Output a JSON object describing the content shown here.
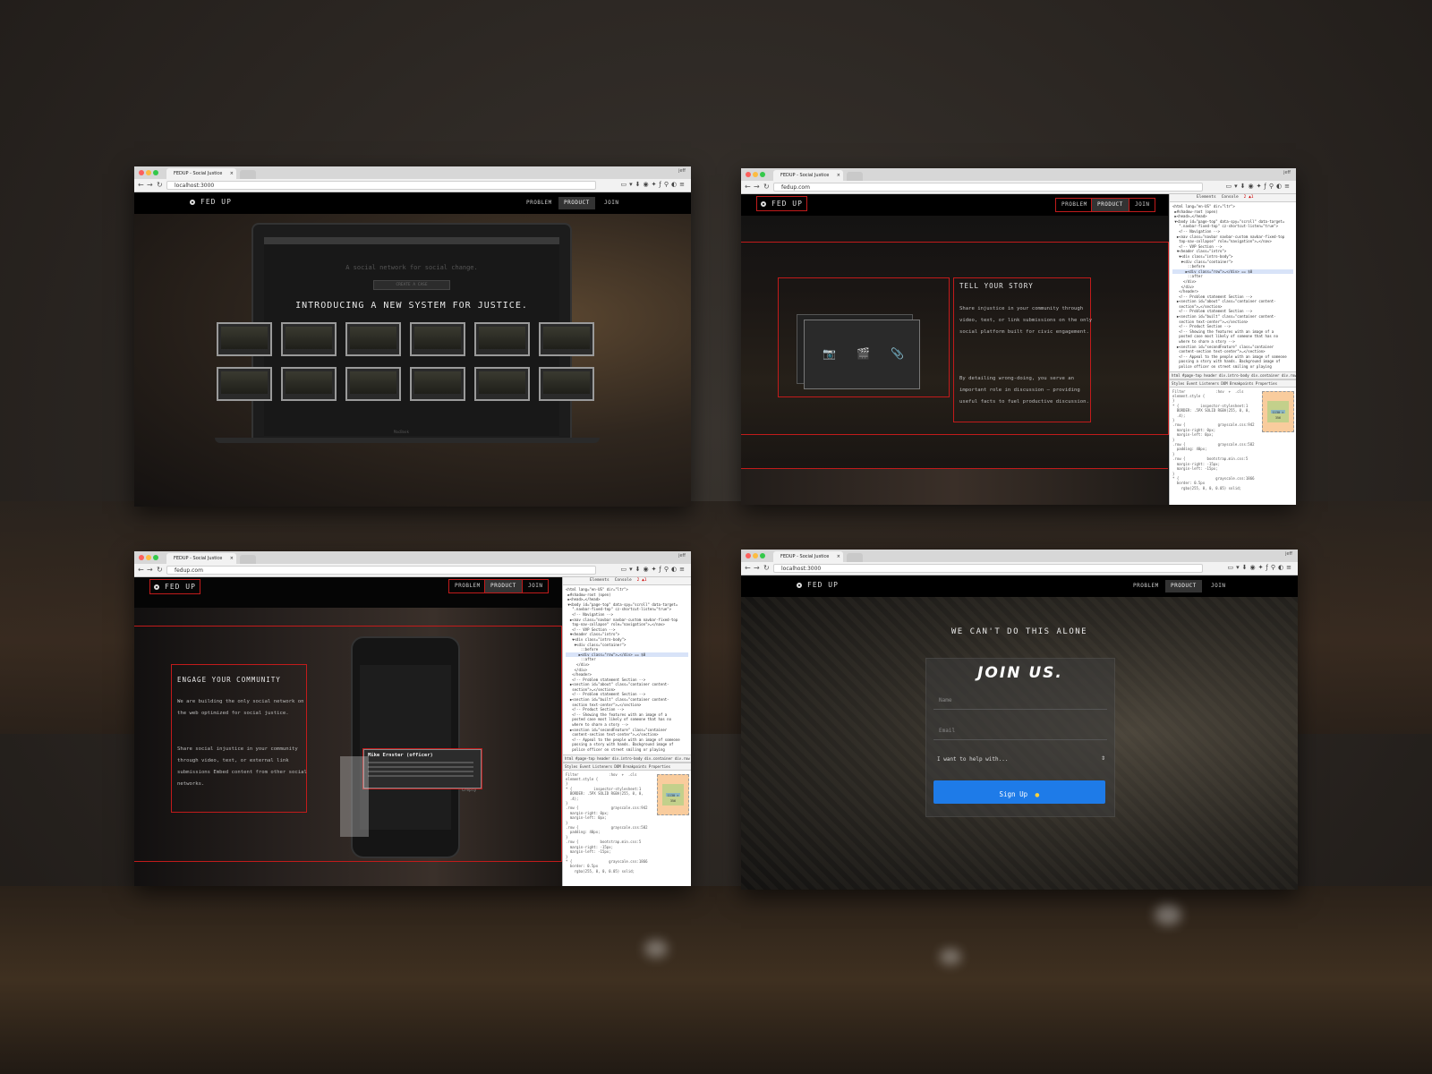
{
  "windows": {
    "w1": {
      "tab_title": "FEDUP - Social Justice",
      "user": "jeff",
      "url": "localhost:3000",
      "brand": "FED UP",
      "nav": [
        "PROBLEM",
        "PRODUCT",
        "JOIN"
      ],
      "laptop_tagline": "A social network for social change.",
      "laptop_button": "CREATE A CASE",
      "headline": "INTRODUCING A NEW SYSTEM FOR JUSTICE.",
      "laptop_brand": "MacBook",
      "card_count": 12
    },
    "w2": {
      "tab_title": "FEDUP - Social Justice",
      "user": "jeff",
      "url": "fedup.com",
      "brand": "FED UP",
      "nav": [
        "PROBLEM",
        "PRODUCT",
        "JOIN"
      ],
      "heading": "TELL YOUR STORY",
      "para1": "Share injustice in your community through video, text, or link submissions on the only social platform built for civic engagement.",
      "para2": "By detailing wrong-doing, you serve an important role in discussion — providing useful facts to fuel productive discussion."
    },
    "w3": {
      "tab_title": "FEDUP - Social Justice",
      "user": "jeff",
      "url": "fedup.com",
      "brand": "FED UP",
      "nav": [
        "PROBLEM",
        "PRODUCT",
        "JOIN"
      ],
      "heading": "ENGAGE YOUR COMMUNITY",
      "para1": "We are building the only social network on the web optimized for social justice.",
      "para2": "Share social injustice in your community through video, text, or external link submissions Embed content from other social networks.",
      "phone_card_title": "Mike Ernster (officer)",
      "phone_card_reply": "reply"
    },
    "w4": {
      "tab_title": "FEDUP - Social Justice",
      "user": "jeff",
      "url": "localhost:3000",
      "brand": "FED UP",
      "nav": [
        "PROBLEM",
        "PRODUCT",
        "JOIN"
      ],
      "heading": "WE CAN'T DO THIS ALONE",
      "join_title": "JOIN US.",
      "name_placeholder": "Name",
      "email_placeholder": "Email",
      "select_value": "I want to help with...",
      "signup_label": "Sign Up"
    }
  },
  "devtools": {
    "tabs": [
      "Elements",
      "Console"
    ],
    "badge": "2 ▲1",
    "lines": [
      "<html lang=\"en-US\" dir=\"ltr\">",
      " ▶#shadow-root (open)",
      " ▶<head>…</head>",
      " ▼<body id=\"page-top\" data-spy=\"scroll\" data-target=",
      "   \".navbar-fixed-top\" cz-shortcut-listen=\"true\">",
      "   <!-- Navigation -->",
      "  ▶<nav class=\"navbar navbar-custom navbar-fixed-top",
      "   top-nav-collapse\" role=\"navigation\">…</nav>",
      "   <!-- VVP Section -->",
      "  ▼<header class=\"intro\">",
      "   ▼<div class=\"intro-body\">",
      "    ▼<div class=\"container\">",
      "       ::before",
      "      ▶<div class=\"row\">…</div> == $0",
      "       ::after",
      "     </div>",
      "    </div>",
      "   </header>",
      "   <!-- Problem statement Section -->",
      "  ▶<section id=\"about\" class=\"container content-",
      "   section\">…</section>",
      "   <!-- Problem statement Section -->",
      "  ▶<section id=\"built\" class=\"container content-",
      "   section text-center\">…</section>",
      "   <!-- Product Section -->",
      "   <!-- Showing the features with an image of a",
      "   posted case most likely of someone that has no",
      "   where to share a story -->",
      "  ▶<section id=\"secondFeature\" class=\"container",
      "   content-section text-center\">…</section>",
      "   <!-- Appeal to the people with an image of someone",
      "   passing a story with hands. Background image of",
      "   police officer on street smiling or playing"
    ],
    "crumbs": "html  #page-top  header  div.intro-body  div.container  div.row",
    "subtabs": "Styles  Event Listeners  DOM Breakpoints  Properties",
    "styles": [
      "Filter              :hov  +  .cls",
      "element.style {",
      "}",
      "* {          inspector-stylesheet:1",
      "  BORDER: .5PX SOLID RGBA(255, 0, 0,",
      "  .4);",
      "}",
      ".row {               grayscale.css:942",
      "  margin-right: 0px;",
      "  margin-left: 0px;",
      "}",
      ".row {               grayscale.css:582",
      "  padding: 40px;",
      "}",
      ".row {          bootstrap.min.css:5",
      "  margin-right: -15px;",
      "  margin-left: -15px;",
      "}",
      "* {                 grayscale.css:1866",
      "  border: 0.5px",
      "    rgba(255, 0, 0, 0.05) solid;"
    ],
    "box_size": "1130 × 356"
  },
  "colors": {
    "signup_button": "#1e7be8",
    "outline_red": "#c21b1b",
    "nav_bg": "#000000"
  }
}
